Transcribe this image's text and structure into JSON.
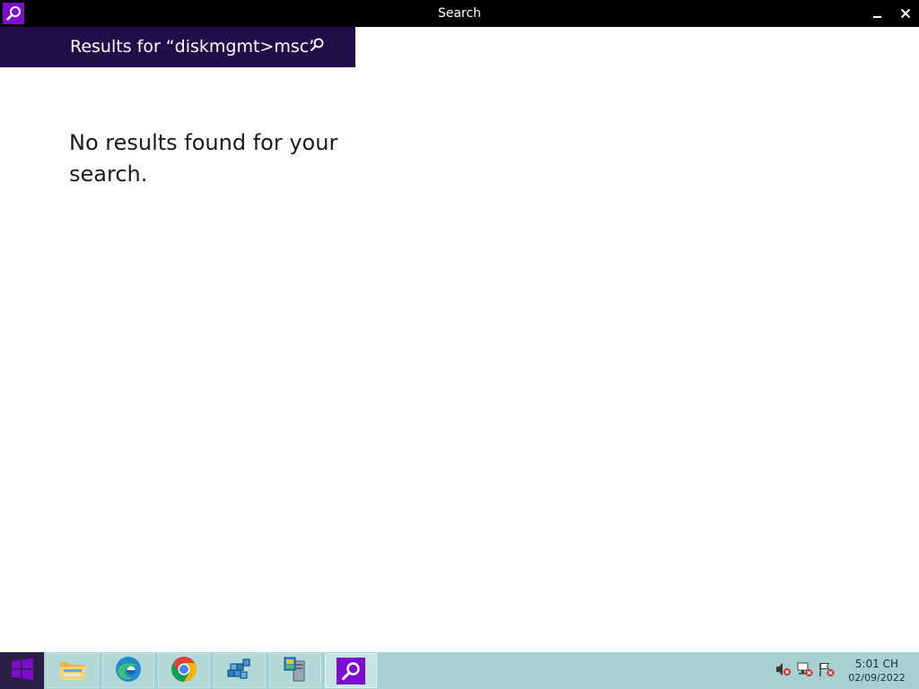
{
  "window": {
    "title": "Search",
    "app_icon": "search-icon",
    "minimize_icon": "minimize-icon",
    "close_icon": "close-icon"
  },
  "search_header": {
    "results_label": "Results for “diskmgmt>msc”",
    "search_icon": "search-icon"
  },
  "main": {
    "message": "No results found for your search."
  },
  "taskbar": {
    "start_icon": "windows-logo-icon",
    "pinned": [
      {
        "name": "File Explorer",
        "icon": "file-explorer-icon"
      },
      {
        "name": "Microsoft Edge",
        "icon": "edge-icon"
      },
      {
        "name": "Google Chrome",
        "icon": "chrome-icon"
      },
      {
        "name": "Registry Editor",
        "icon": "registry-editor-icon"
      },
      {
        "name": "Server Manager",
        "icon": "server-manager-icon"
      },
      {
        "name": "Search",
        "icon": "search-icon",
        "active": true
      }
    ],
    "tray": [
      {
        "icon": "speaker-muted-icon"
      },
      {
        "icon": "network-error-icon"
      },
      {
        "icon": "action-center-flag-icon"
      }
    ],
    "clock": {
      "time": "5:01 CH",
      "date": "02/09/2022"
    }
  },
  "colors": {
    "accent": "#7e0ccf",
    "header_background": "#220c4a",
    "titlebar_background": "#000000",
    "taskbar_background": "#a8d2d2",
    "start_background": "#2a2046"
  }
}
